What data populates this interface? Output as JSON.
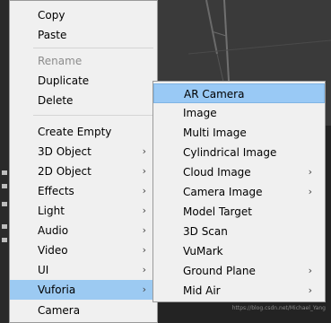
{
  "main_menu": {
    "items": [
      {
        "label": "Copy",
        "submenu": false,
        "disabled": false
      },
      {
        "label": "Paste",
        "submenu": false,
        "disabled": false
      },
      {
        "label": "Rename",
        "submenu": false,
        "disabled": true
      },
      {
        "label": "Duplicate",
        "submenu": false,
        "disabled": false
      },
      {
        "label": "Delete",
        "submenu": false,
        "disabled": false
      },
      {
        "label": "Create Empty",
        "submenu": false,
        "disabled": false
      },
      {
        "label": "3D Object",
        "submenu": true,
        "disabled": false
      },
      {
        "label": "2D Object",
        "submenu": true,
        "disabled": false
      },
      {
        "label": "Effects",
        "submenu": true,
        "disabled": false
      },
      {
        "label": "Light",
        "submenu": true,
        "disabled": false
      },
      {
        "label": "Audio",
        "submenu": true,
        "disabled": false
      },
      {
        "label": "Video",
        "submenu": true,
        "disabled": false
      },
      {
        "label": "UI",
        "submenu": true,
        "disabled": false
      },
      {
        "label": "Vuforia",
        "submenu": true,
        "disabled": false,
        "active": true
      },
      {
        "label": "Camera",
        "submenu": false,
        "disabled": false
      }
    ]
  },
  "submenu": {
    "items": [
      {
        "label": "AR Camera",
        "submenu": false,
        "highlighted": true
      },
      {
        "label": "Image",
        "submenu": false
      },
      {
        "label": "Multi Image",
        "submenu": false
      },
      {
        "label": "Cylindrical Image",
        "submenu": false
      },
      {
        "label": "Cloud Image",
        "submenu": true
      },
      {
        "label": "Camera Image",
        "submenu": true
      },
      {
        "label": "Model Target",
        "submenu": false
      },
      {
        "label": "3D Scan",
        "submenu": false
      },
      {
        "label": "VuMark",
        "submenu": false
      },
      {
        "label": "Ground Plane",
        "submenu": true
      },
      {
        "label": "Mid Air",
        "submenu": true
      }
    ]
  },
  "arrow_glyph": "›",
  "watermark": "https://blog.csdn.net/Michael_Yang",
  "colors": {
    "menu_bg": "#f0f0f0",
    "highlight": "#99c9f5",
    "disabled_text": "#8c8c8c"
  }
}
